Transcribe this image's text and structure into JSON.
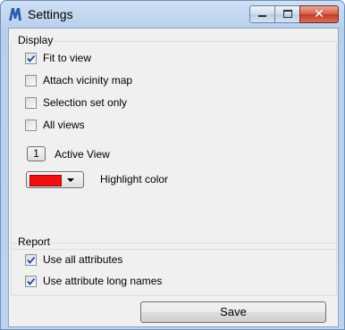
{
  "window": {
    "title": "Settings",
    "icon": "app-logo-icon",
    "controls": [
      "minimize-icon",
      "maximize-icon",
      "close-icon"
    ],
    "close_glyph": "✕"
  },
  "display": {
    "legend": "Display",
    "options": [
      {
        "label": "Fit to view",
        "checked": true
      },
      {
        "label": "Attach vicinity map",
        "checked": false
      },
      {
        "label": "Selection set only",
        "checked": false
      },
      {
        "label": "All views",
        "checked": false
      }
    ],
    "active_view": {
      "value": "1",
      "label": "Active View"
    },
    "highlight": {
      "color": "#ee1111",
      "label": "Highlight color"
    }
  },
  "report": {
    "legend": "Report",
    "options": [
      {
        "label": "Use all attributes",
        "checked": true
      },
      {
        "label": "Use attribute long names",
        "checked": true
      }
    ]
  },
  "actions": {
    "save_label": "Save"
  },
  "colors": {
    "check": "#1c4fa8",
    "title_bar": "#c2d6f0",
    "panel": "#f0f0f0"
  }
}
